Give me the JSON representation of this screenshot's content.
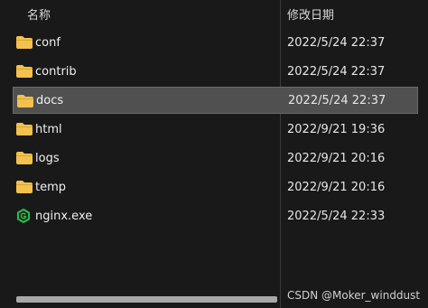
{
  "header": {
    "name_label": "名称",
    "date_label": "修改日期",
    "sort_indicator": "^"
  },
  "files": [
    {
      "name": "conf",
      "date": "2022/5/24 22:37",
      "type": "folder",
      "selected": false
    },
    {
      "name": "contrib",
      "date": "2022/5/24 22:37",
      "type": "folder",
      "selected": false
    },
    {
      "name": "docs",
      "date": "2022/5/24 22:37",
      "type": "folder",
      "selected": true
    },
    {
      "name": "html",
      "date": "2022/9/21 19:36",
      "type": "folder",
      "selected": false
    },
    {
      "name": "logs",
      "date": "2022/9/21 20:16",
      "type": "folder",
      "selected": false
    },
    {
      "name": "temp",
      "date": "2022/9/21 20:16",
      "type": "folder",
      "selected": false
    },
    {
      "name": "nginx.exe",
      "date": "2022/5/24 22:33",
      "type": "exe",
      "selected": false
    }
  ],
  "watermark": "CSDN @Moker_winddust",
  "colors": {
    "background": "#191919",
    "selected": "#505050",
    "folder": "#f2c14e",
    "exe": "#2fb34a"
  }
}
